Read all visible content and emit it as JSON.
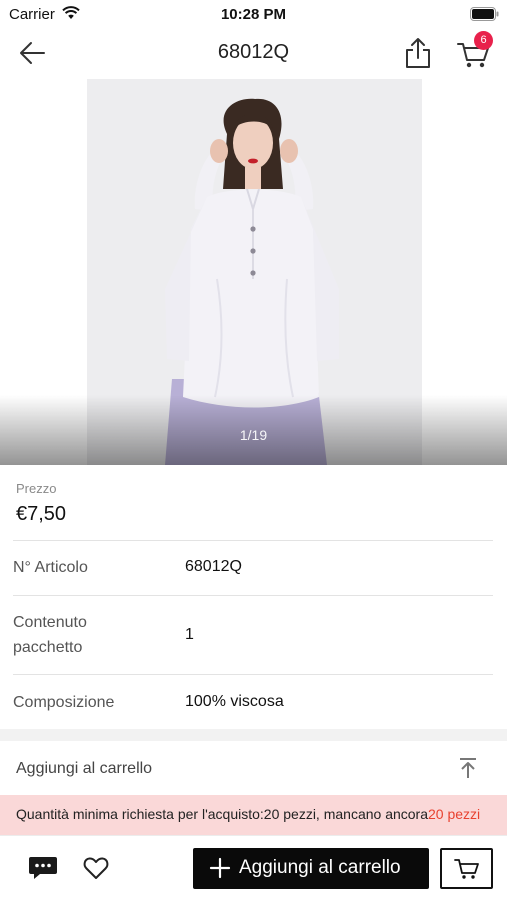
{
  "status_bar": {
    "carrier": "Carrier",
    "time": "10:28 PM"
  },
  "header": {
    "title": "68012Q",
    "cart_count": "6"
  },
  "gallery": {
    "page_indicator": "1/19"
  },
  "price": {
    "label": "Prezzo",
    "value": "€7,50"
  },
  "details": [
    {
      "label": "N° Articolo",
      "value": "68012Q"
    },
    {
      "label": "Contenuto pacchetto",
      "value": "1"
    },
    {
      "label": "Composizione",
      "value": "100% viscosa"
    }
  ],
  "add_section": {
    "label": "Aggiungi al carrello"
  },
  "notice": {
    "text": "Quantità minima richiesta per l'acquisto:20 pezzi,  mancano ancora",
    "highlight": "20 pezzi"
  },
  "toolbar": {
    "add_to_cart_label": "Aggiungi al carrello"
  },
  "icons": {
    "back": "arrow-left-icon",
    "share": "share-icon",
    "cart": "shopping-cart-icon",
    "chat": "chat-bubble-icon",
    "favorite": "heart-icon",
    "scroll_top": "scroll-to-top-icon",
    "plus": "plus-icon"
  },
  "colors": {
    "badge": "#e8214b",
    "notice_bg": "#fad8d8",
    "notice_accent": "#e8412f",
    "primary_button": "#0a0a0a"
  }
}
